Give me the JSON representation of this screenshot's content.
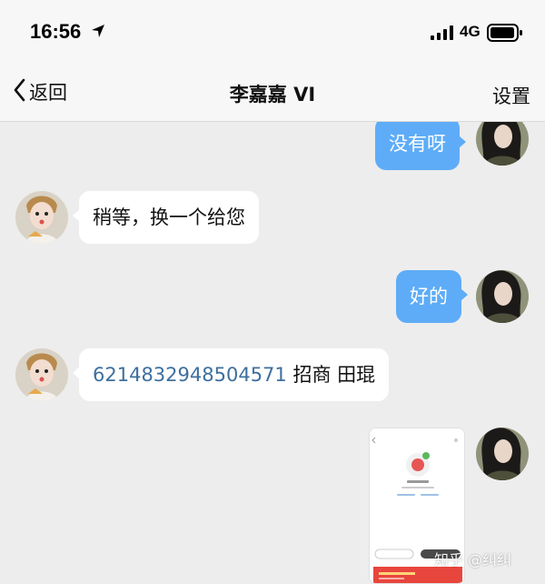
{
  "status_bar": {
    "time": "16:56",
    "network": "4G"
  },
  "nav": {
    "back_label": "返回",
    "title": "李嘉嘉 VI",
    "settings_label": "设置"
  },
  "messages": [
    {
      "side": "out",
      "text": "没有呀"
    },
    {
      "side": "in",
      "text": "稍等，换一个给您"
    },
    {
      "side": "out",
      "text": "好的"
    },
    {
      "side": "in",
      "account": "6214832948504571",
      "suffix": " 招商 田琨"
    },
    {
      "side": "out",
      "type": "image"
    }
  ],
  "image_preview": {
    "status_text": "转账成功",
    "btn_left": "完成",
    "btn_right": "返回首页",
    "banner": "新春好运利是"
  },
  "watermark": "知乎 @纠纠",
  "colors": {
    "out_bubble": "#5eacf7",
    "link": "#3d6f9e",
    "background": "#ededed"
  }
}
